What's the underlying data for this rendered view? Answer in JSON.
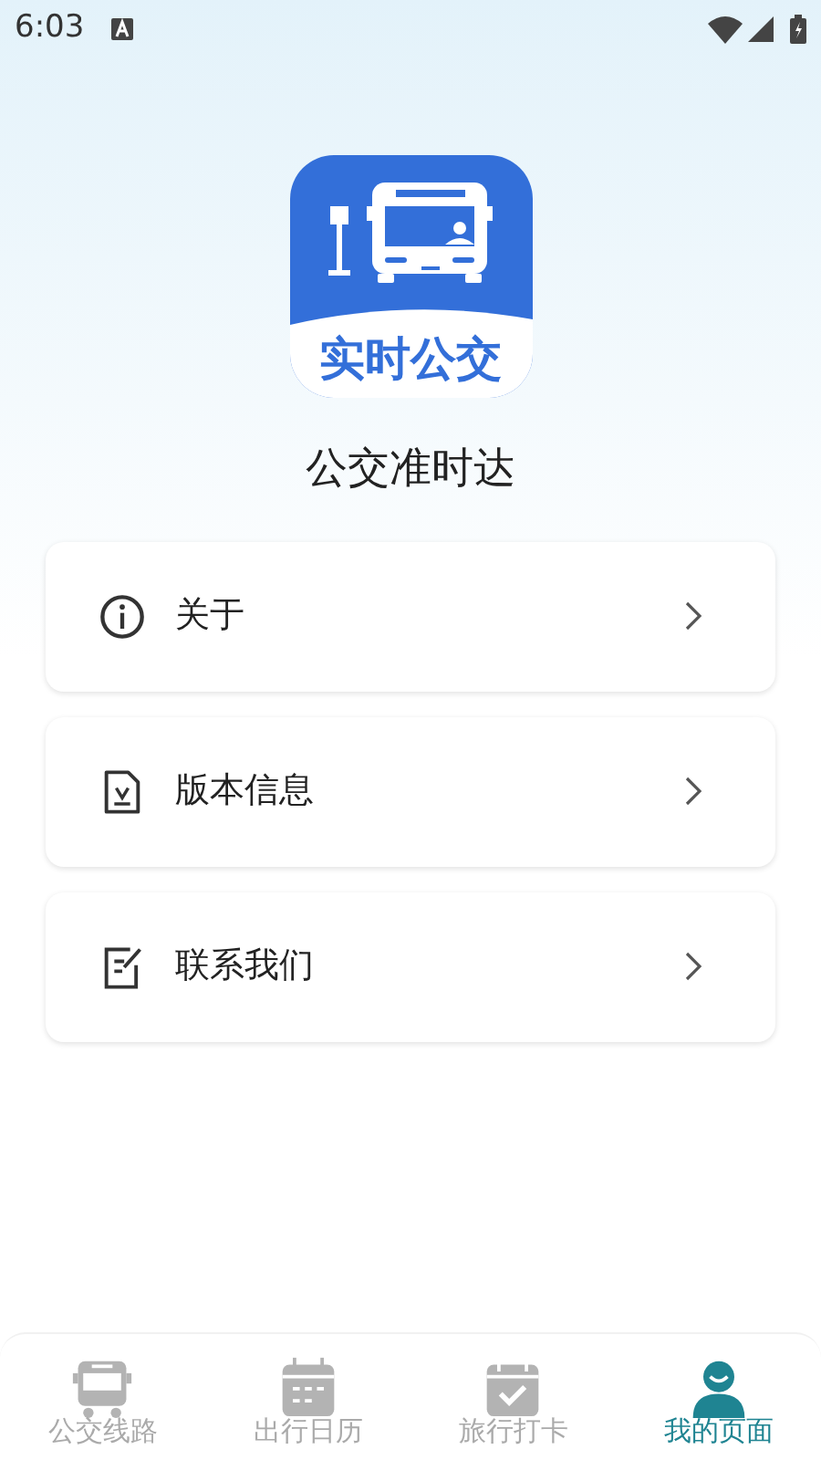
{
  "status_bar": {
    "time": "6:03"
  },
  "app": {
    "logo_text": "实时公交",
    "name": "公交准时达"
  },
  "menu": [
    {
      "label": "关于",
      "kind": "info"
    },
    {
      "label": "版本信息",
      "kind": "document"
    },
    {
      "label": "联系我们",
      "kind": "edit"
    }
  ],
  "bottom_nav": [
    {
      "label": "公交线路",
      "kind": "bus",
      "selected": false
    },
    {
      "label": "出行日历",
      "kind": "calendar",
      "selected": false
    },
    {
      "label": "旅行打卡",
      "kind": "checkin",
      "selected": false
    },
    {
      "label": "我的页面",
      "kind": "profile",
      "selected": true
    }
  ]
}
